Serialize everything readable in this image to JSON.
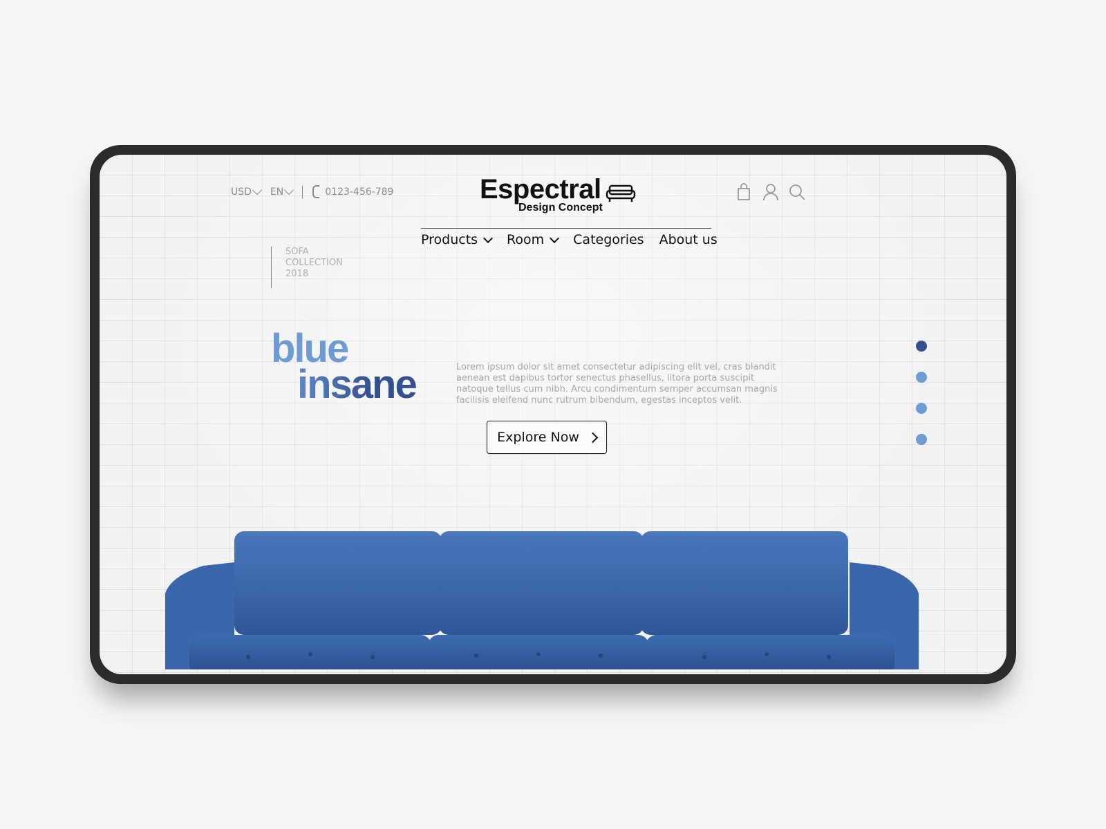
{
  "header": {
    "currency": "USD",
    "language": "EN",
    "phone": "0123-456-789",
    "brand": "Espectral",
    "tagline": "Design Concept"
  },
  "nav": {
    "items": [
      {
        "label": "Products"
      },
      {
        "label": "Room"
      },
      {
        "label": "Categories"
      },
      {
        "label": "About us"
      }
    ]
  },
  "collection": {
    "line1": "SOFA",
    "line2": "COLLECTION",
    "line3": "2018"
  },
  "hero": {
    "line1": "blue",
    "line2": "insane",
    "description": "Lorem ipsum dolor sit amet consectetur adipiscing elit vel, cras blandit aenean est dapibus tortor senectus phasellus, litora porta suscipit natoque tellus cum nibh. Arcu condimentum semper accumsan magnis facilisis eleifend nunc rutrum bibendum, egestas inceptos velit.",
    "cta_label": "Explore Now"
  },
  "slider": {
    "total": 4,
    "active_index": 0
  },
  "colors": {
    "accent_light": "#6f9bd4",
    "accent_dark": "#34508f",
    "sofa": "#3f6db2"
  },
  "icons": [
    "bag-icon",
    "user-icon",
    "search-icon",
    "phone-icon",
    "sofa-icon"
  ]
}
